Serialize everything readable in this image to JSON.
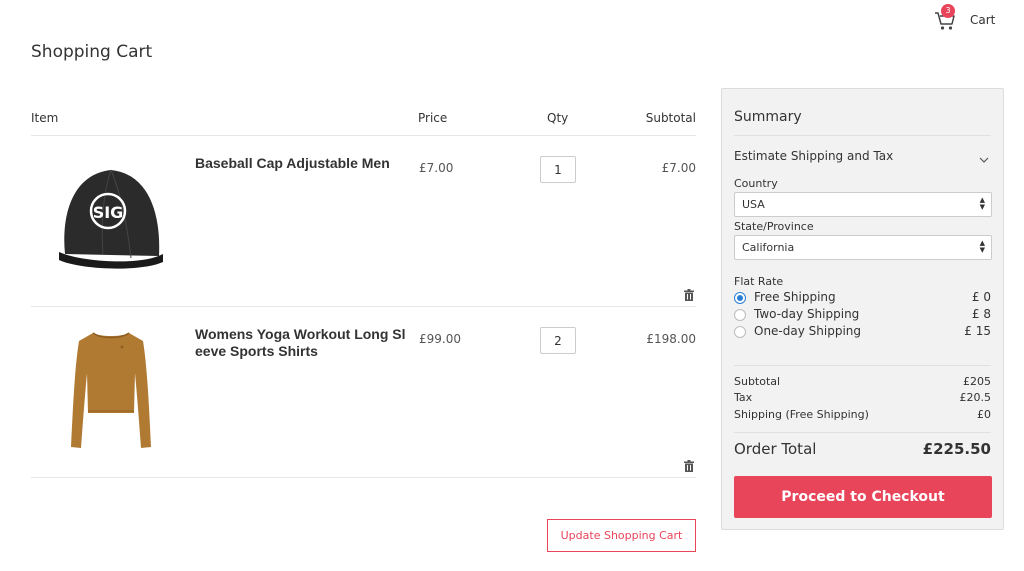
{
  "header": {
    "cart_label": "Cart",
    "cart_count": "3"
  },
  "page_title": "Shopping Cart",
  "table": {
    "columns": {
      "item": "Item",
      "price": "Price",
      "qty": "Qty",
      "subtotal": "Subtotal"
    },
    "rows": [
      {
        "name": "Baseball Cap Adjustable Men",
        "price": "£7.00",
        "qty": "1",
        "subtotal": "£7.00",
        "image": "black-cap-image"
      },
      {
        "name": "Womens Yoga Workout Long Sleeve Sports Shirts",
        "price": "£99.00",
        "qty": "2",
        "subtotal": "£198.00",
        "image": "tan-long-sleeve-top-image"
      }
    ],
    "update_label": "Update Shopping Cart"
  },
  "summary": {
    "title": "Summary",
    "estimate_label": "Estimate Shipping and Tax",
    "country_label": "Country",
    "country_value": "USA",
    "state_label": "State/Province",
    "state_value": "California",
    "flat_rate_label": "Flat Rate",
    "shipping_options": [
      {
        "label": "Free Shipping",
        "price": "£ 0",
        "selected": true
      },
      {
        "label": "Two-day Shipping",
        "price": "£ 8",
        "selected": false
      },
      {
        "label": "One-day Shipping",
        "price": "£ 15",
        "selected": false
      }
    ],
    "totals": [
      {
        "label": "Subtotal",
        "value": "£205"
      },
      {
        "label": "Tax",
        "value": "£20.5"
      },
      {
        "label": "Shipping (Free Shipping)",
        "value": "£0"
      }
    ],
    "order_total_label": "Order Total",
    "order_total_value": "£225.50",
    "checkout_label": "Proceed to Checkout"
  },
  "colors": {
    "accent": "#e8445a",
    "radio_selected": "#2a7fd4",
    "summary_bg": "#f2f2f2"
  }
}
